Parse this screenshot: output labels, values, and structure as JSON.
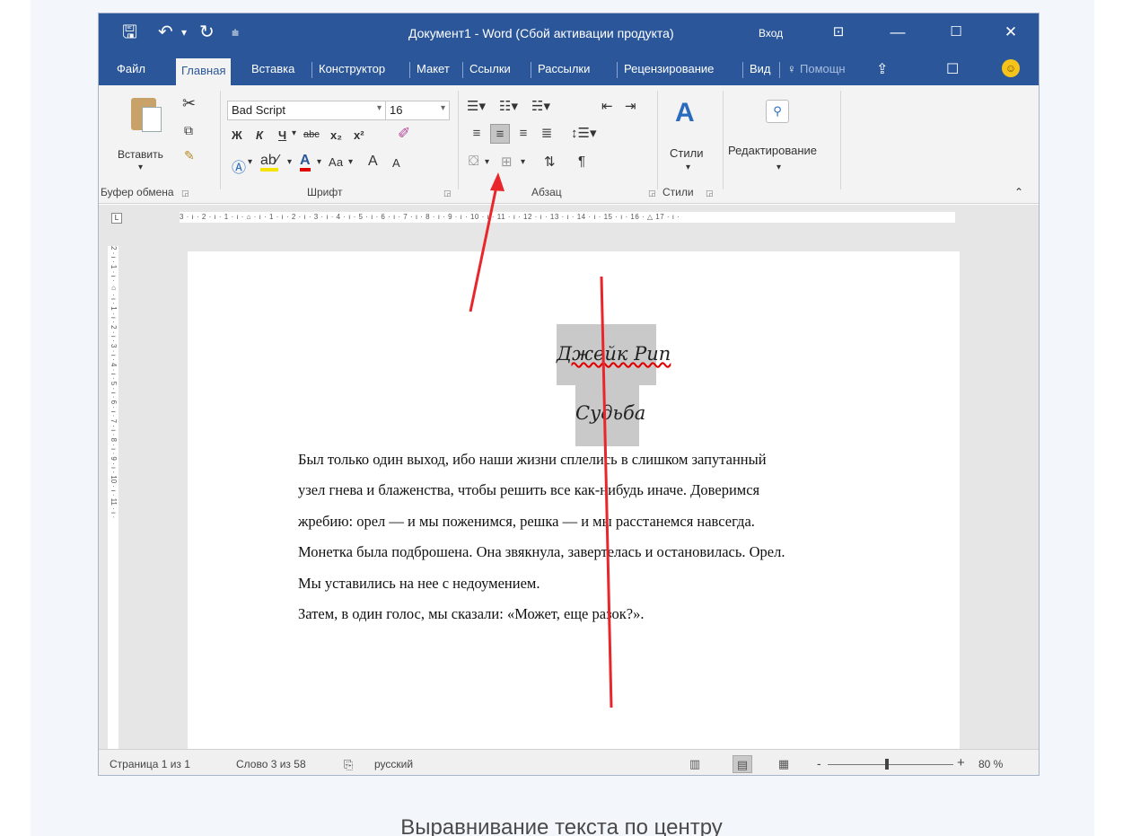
{
  "window": {
    "title": "Документ1  -  Word (Сбой активации продукта)",
    "signin": "Вход",
    "qat": {
      "save_icon": "save-icon",
      "undo_icon": "undo-icon",
      "redo_icon": "redo-icon"
    }
  },
  "tabs": [
    "Файл",
    "Главная",
    "Вставка",
    "Конструктор",
    "Макет",
    "Ссылки",
    "Рассылки",
    "Рецензирование",
    "Вид"
  ],
  "tell_me": "Помощн",
  "ribbon": {
    "clipboard": {
      "paste_label": "Вставить",
      "group_label": "Буфер обмена"
    },
    "font": {
      "font_name": "Bad Script",
      "font_size": "16",
      "bold": "Ж",
      "italic": "К",
      "underline": "Ч",
      "strike": "abc",
      "subscript": "x₂",
      "superscript": "x²",
      "case": "Аа",
      "grow": "A",
      "shrink": "A",
      "group_label": "Шрифт"
    },
    "paragraph": {
      "group_label": "Абзац",
      "pilcrow": "¶"
    },
    "styles": {
      "label": "Стили",
      "group_label": "Стили"
    },
    "editing": {
      "label": "Редактирование"
    }
  },
  "ruler": {
    "horizontal": "3 · ı · 2 · ı · 1 · ı · ⌂ · ı · 1 · ı · 2 · ı · 3 · ı · 4 · ı · 5 · ı · 6 · ı · 7 · ı · 8 · ı · 9 · ı · 10 · ı · 11 · ı · 12 · ı · 13 · ı · 14 · ı · 15 · ı · 16 · △ 17 · ı ·",
    "vertical": "2 · ı · 1 · ı · ⌂ · ı · 1 · ı · 2 · ı · 3 · ı · 4 · ı · 5 · ı · 6 · ı · 7 · ı · 8 · ı · 9 · ı · 10 · ı · 11 · ı ·",
    "corner": "L"
  },
  "document": {
    "author": "Джейк Рип",
    "title": "Судьба",
    "paragraphs": [
      "Был только один выход, ибо наши жизни сплелись в слишком запутанный",
      "узел гнева и блаженства, чтобы решить все как-нибудь иначе. Доверимся",
      "жребию: орел — и мы поженимся, решка — и мы расстанемся навсегда.",
      "Монетка была подброшена. Она звякнула, завертелась и остановилась. Орел.",
      "Мы уставились на нее с недоумением.",
      "Затем, в один голос, мы сказали: «Может, еще разок?»."
    ]
  },
  "status": {
    "page": "Страница 1 из 1",
    "words": "Слово 3 из 58",
    "language": "русский",
    "zoom_minus": "-",
    "zoom_plus": "+",
    "zoom": "80 %"
  },
  "caption": "Выравнивание текста по центру",
  "colors": {
    "title_bar": "#2b579a",
    "arrow": "#e8262b",
    "highlight": "#c9c9c9"
  }
}
